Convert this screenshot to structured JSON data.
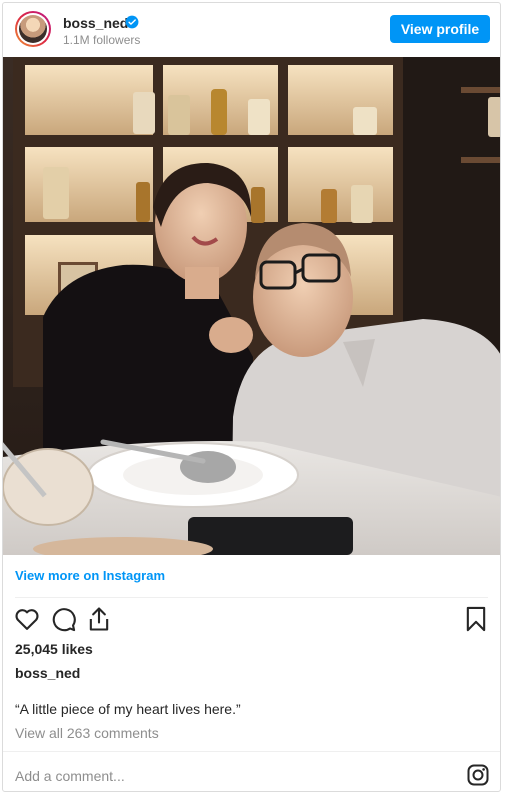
{
  "header": {
    "username": "boss_ned",
    "followers": "1.1M followers",
    "view_profile_label": "View profile"
  },
  "footer": {
    "view_more_label": "View more on Instagram",
    "likes": "25,045 likes",
    "owner": "boss_ned",
    "caption": "“A little piece of my heart lives here.”",
    "view_comments": "View all 263 comments",
    "add_comment_placeholder": "Add a comment..."
  },
  "icons": {
    "verified": "verified-badge-icon",
    "like": "heart-icon",
    "comment": "comment-bubble-icon",
    "share": "share-icon",
    "save": "bookmark-icon",
    "instagram": "instagram-logo-icon"
  },
  "colors": {
    "accent": "#0095f6",
    "text": "#262626",
    "muted": "#8e8e8e"
  }
}
